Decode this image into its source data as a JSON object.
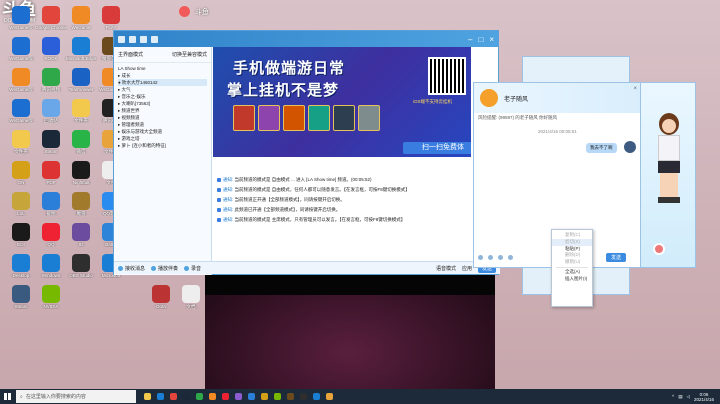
{
  "watermark": {
    "text": "斗鱼",
    "sub": "DOUYU.COM",
    "right_label": "斗鱼"
  },
  "desktop_icons": [
    {
      "label": "WeGame版",
      "color": "#1c6fd1"
    },
    {
      "label": "Google Chrome",
      "color": "#e2453c"
    },
    {
      "label": "WeGame",
      "color": "#f08a24"
    },
    {
      "label": "FLAT",
      "color": "#d93a3a"
    },
    {
      "label": "WeGame版",
      "color": "#1c6fd1"
    },
    {
      "label": "KOOK",
      "color": "#2b5fd9"
    },
    {
      "label": "Microsoft Edge",
      "color": "#1a7fd4"
    },
    {
      "label": "魔兽争霸",
      "color": "#6b4b1d"
    },
    {
      "label": "WeGame版",
      "color": "#f08a24"
    },
    {
      "label": "腾讯视频",
      "color": "#2fa84a"
    },
    {
      "label": "TeamViewer",
      "color": "#1a62c4"
    },
    {
      "label": "WeGame版",
      "color": "#f08a24"
    },
    {
      "label": "WeGame版",
      "color": "#1c6fd1"
    },
    {
      "label": "回收站",
      "color": "#6aa7e8"
    },
    {
      "label": "文件夹",
      "color": "#f2c94c"
    },
    {
      "label": "腾讯QQ",
      "color": "#222"
    },
    {
      "label": "文件夹",
      "color": "#f2c94c"
    },
    {
      "label": "Steam",
      "color": "#1b2838"
    },
    {
      "label": "微信",
      "color": "#28b446"
    },
    {
      "label": "文件夹",
      "color": "#e8a33a"
    },
    {
      "label": "ON",
      "color": "#d4a017"
    },
    {
      "label": "PDF",
      "color": "#d33"
    },
    {
      "label": "Nightfall",
      "color": "#1a1a1a"
    },
    {
      "label": "文档",
      "color": "#eee"
    },
    {
      "label": "LoL",
      "color": "#c6a53a"
    },
    {
      "label": "截图",
      "color": "#2b7fd8"
    },
    {
      "label": "魔兽",
      "color": "#a27a2c"
    },
    {
      "label": "QQ影音",
      "color": "#2b8cf0"
    },
    {
      "label": "EDI",
      "color": "#1a1a1a"
    },
    {
      "label": "QQ",
      "color": "#e23"
    },
    {
      "label": "ID",
      "color": "#6b4c9e"
    },
    {
      "label": "Battle",
      "color": "#2d84d8"
    },
    {
      "label": "Desktop",
      "color": "#1a7fd4"
    },
    {
      "label": "Windows",
      "color": "#1a7fd4"
    },
    {
      "label": "OBS Studio",
      "color": "#2e2e2e"
    },
    {
      "label": "Microsoft",
      "color": "#1a7fd4"
    },
    {
      "label": "Steam",
      "color": "#3a5a80"
    },
    {
      "label": "NVIDIA",
      "color": "#76b900"
    },
    {
      "label": "Dota",
      "color": "#b33"
    },
    {
      "label": "文档",
      "color": "#eee"
    }
  ],
  "main_window": {
    "left_header": "主界面模式",
    "left_header_right": "切换至兼容模式",
    "tree": [
      "LA Show time",
      "▸ 成长",
      "● 吹水大厅1460142",
      "  ▸ 大气",
      "    ▸ 音乐之-娱乐",
      "  ▸ 大喇叭[73563]",
      "▸ 频道世界",
      "▸ 视频频道",
      "▸ 管理者频道",
      "▸ 娱乐与游戏大全频道",
      "▸ 游戏之塔",
      "▸ 萝卜 (连小和者的特征)"
    ],
    "banner_line1": "手机做端游日常",
    "banner_line2": "掌上挂机不是梦",
    "banner_scan": "扫一扫免费体",
    "banner_sub": "iOS端不支持云挂机",
    "messages": [
      {
        "prefix": "通知:",
        "text": "当前频道的模式是 自由模式 ...  进入 [LA Show time] 频道。(00:05:52)"
      },
      {
        "prefix": "通知:",
        "text": "当前频道的模式是 自由模式，任何人都可以随意发言。【在发言框，可按F8键切换模式】"
      },
      {
        "prefix": "通知:",
        "text": "当前频道正开通【全部频道模式】，同请按键开启切换。"
      },
      {
        "prefix": "通知:",
        "text": "此频道已开通【全部频道模式】，同请按键开启切换。"
      },
      {
        "prefix": "通知:",
        "text": "当前频道的模式是 主席模式，只有管理员可以发言。【在发言框，可按F8键切换模式】"
      }
    ],
    "footer": [
      "接收消息",
      "播放伴奏",
      "录音"
    ],
    "footer_right": [
      "语音模式",
      "应用"
    ],
    "footer_send": "发送"
  },
  "chat_window": {
    "name": "老子随风",
    "notice": "风险提醒: (99597) 的老子随风 你好随风",
    "time": "2021/4/16 00:05:51",
    "bubble": "我去不了啊",
    "send": "发送"
  },
  "context_menu": [
    {
      "label": "复制(C)",
      "disabled": true
    },
    {
      "label": "剪切(X)",
      "disabled": true,
      "hover": true
    },
    {
      "label": "粘贴(P)",
      "disabled": false
    },
    {
      "label": "删除(D)",
      "disabled": true
    },
    {
      "label": "撤销(U)",
      "disabled": true
    },
    {
      "label": "全选(A)",
      "disabled": false
    },
    {
      "label": "插入图片(I)",
      "disabled": false
    }
  ],
  "taskbar": {
    "search_placeholder": "在这里输入你要搜索的内容",
    "time": "0:06",
    "date": "2021/4/16",
    "icons": [
      "#f2c94c",
      "#1a7fd4",
      "#e2453c",
      "#1b2838",
      "#2fa84a",
      "#f08a24",
      "#e23",
      "#8c5cd0",
      "#2b7fd8",
      "#d4a017",
      "#76b900",
      "#6b4b1d",
      "#2e2e2e",
      "#1a7fd4",
      "#e8a33a"
    ]
  }
}
